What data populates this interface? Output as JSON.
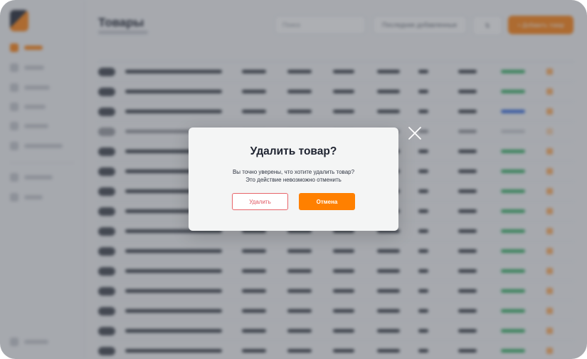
{
  "app": {
    "page_title": "Товары",
    "search": {
      "placeholder": "Поиск"
    },
    "sort": {
      "value": "Последние добавленные"
    },
    "filter": {
      "label": "⇅"
    },
    "add_button": {
      "label": "+ Добавить товар"
    },
    "colors": {
      "accent": "#ff8000",
      "danger": "#e05560",
      "overlay": "rgba(60,64,74,0.42)"
    }
  },
  "modal": {
    "title": "Удалить товар?",
    "message_line1": "Вы точно уверены, что хотите удалить товар?",
    "message_line2": "Это действие невозможно отменить",
    "delete_label": "Удалить",
    "cancel_label": "Отмена",
    "close_icon": "close-icon"
  }
}
